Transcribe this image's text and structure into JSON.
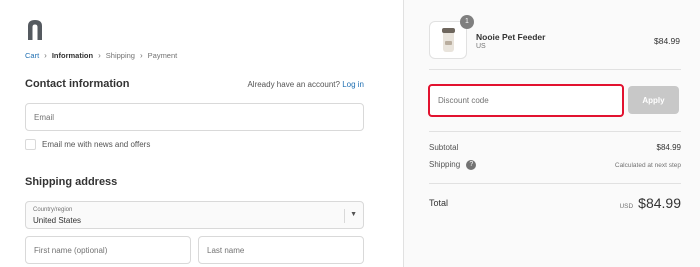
{
  "brand": {
    "logo_icon": "store-logo-icon"
  },
  "breadcrumb": {
    "items": [
      {
        "label": "Cart",
        "state": "link"
      },
      {
        "label": "Information",
        "state": "current"
      },
      {
        "label": "Shipping",
        "state": "upcoming"
      },
      {
        "label": "Payment",
        "state": "upcoming"
      }
    ],
    "separator": "›"
  },
  "contact": {
    "heading": "Contact information",
    "account_prompt": "Already have an account?",
    "login_label": "Log in",
    "email_placeholder": "Email",
    "newsletter_label": "Email me with news and offers",
    "newsletter_checked": false
  },
  "shipping": {
    "heading": "Shipping address",
    "country_label": "Country/region",
    "country_value": "United States",
    "first_name_placeholder": "First name (optional)",
    "last_name_placeholder": "Last name"
  },
  "order": {
    "product": {
      "name": "Nooie Pet Feeder",
      "variant": "US",
      "price": "$84.99",
      "quantity": "1"
    },
    "discount_placeholder": "Discount code",
    "apply_label": "Apply",
    "subtotal_label": "Subtotal",
    "subtotal_value": "$84.99",
    "shipping_label": "Shipping",
    "shipping_value": "Calculated at next step",
    "total_label": "Total",
    "currency": "USD",
    "total_value": "$84.99"
  },
  "colors": {
    "link": "#1f6fb2",
    "highlight": "#e2122f",
    "apply_disabled": "#c8c8c8",
    "sidebar_bg": "#fafafa"
  }
}
